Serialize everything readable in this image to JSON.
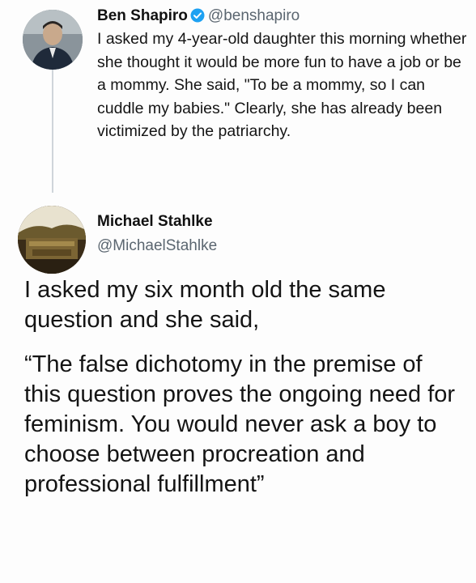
{
  "tweet_original": {
    "author_name": "Ben Shapiro",
    "author_handle": "@benshapiro",
    "verified": true,
    "text": "I asked my 4-year-old daughter this morning whether she thought it would be more fun to have a job or be a mommy. She said, \"To be a mommy, so I can cuddle my babies.\" Clearly, she has already been victimized by the patriarchy."
  },
  "tweet_reply": {
    "author_name": "Michael Stahlke",
    "author_handle": "@MichaelStahlke",
    "paragraphs": [
      "I asked my six month old the same question and she said,",
      "“The false dichotomy in the premise of this question proves the ongoing need for feminism. You would never ask a boy to choose between procreation and professional fulfillment”"
    ]
  },
  "colors": {
    "verified_badge": "#1da1f2",
    "handle_text": "#5b6670",
    "thread_line": "#cfd5da"
  }
}
